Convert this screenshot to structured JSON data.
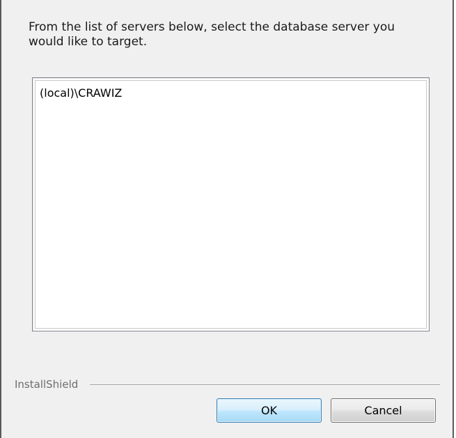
{
  "dialog": {
    "instructions": "From the list of servers below, select the database server you would like to target."
  },
  "server_list": {
    "items": [
      "(local)\\CRAWIZ"
    ]
  },
  "footer": {
    "brand": "InstallShield",
    "ok_label": "OK",
    "cancel_label": "Cancel"
  },
  "colors": {
    "dialog_background": "#f0f0f0",
    "ok_border": "#3c7fb1",
    "brand_text": "#6d6d6d"
  }
}
